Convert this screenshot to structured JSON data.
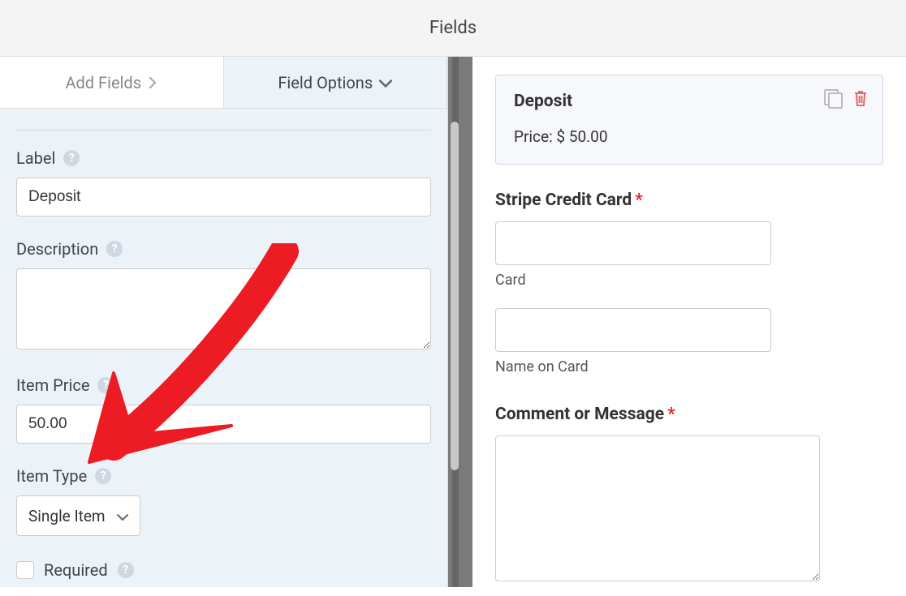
{
  "header": {
    "title": "Fields"
  },
  "tabs": {
    "add": {
      "label": "Add Fields"
    },
    "options": {
      "label": "Field Options"
    }
  },
  "fieldOptions": {
    "labelTitle": "Label",
    "labelValue": "Deposit",
    "descriptionTitle": "Description",
    "descriptionValue": "",
    "itemPriceTitle": "Item Price",
    "itemPriceValue": "50.00",
    "itemTypeTitle": "Item Type",
    "itemTypeValue": "Single Item",
    "requiredLabel": "Required"
  },
  "preview": {
    "deposit": {
      "title": "Deposit",
      "priceLabel": "Price: $ 50.00"
    },
    "stripe": {
      "title": "Stripe Credit Card",
      "cardSub": "Card",
      "nameSub": "Name on Card"
    },
    "comment": {
      "title": "Comment or Message"
    }
  }
}
